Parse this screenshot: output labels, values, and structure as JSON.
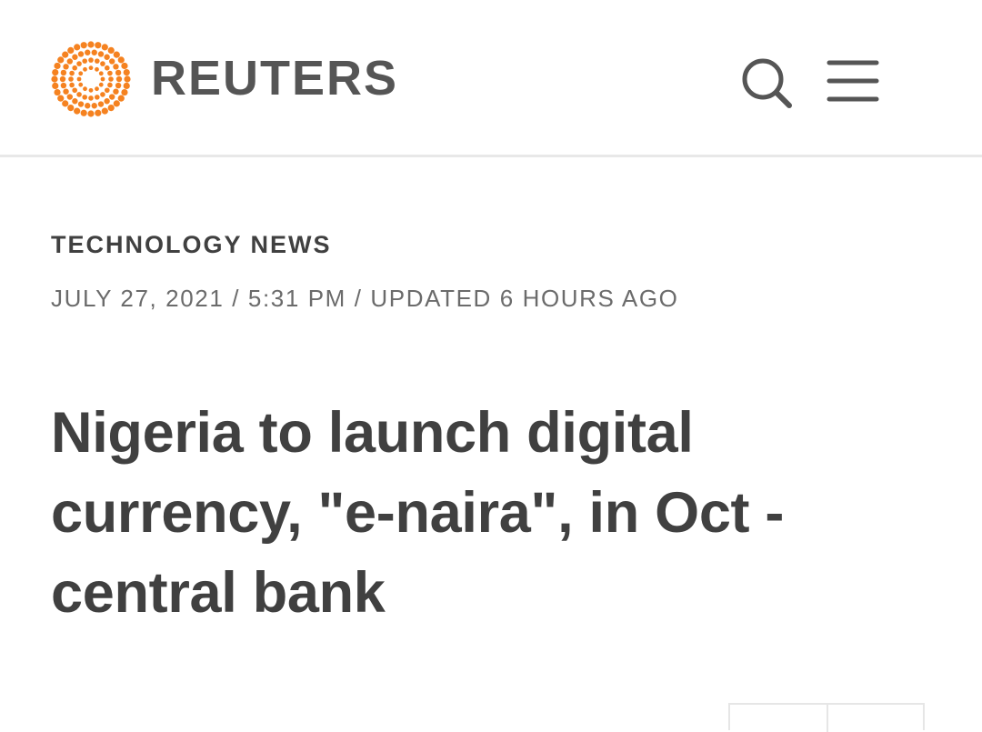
{
  "header": {
    "brand": "REUTERS",
    "logo_icon": "reuters-dot-ring-logo",
    "logo_color": "#f58220",
    "search_icon": "search-icon",
    "menu_icon": "hamburger-menu-icon"
  },
  "article": {
    "section": "TECHNOLOGY NEWS",
    "dateline": "JULY 27, 2021 / 5:31 PM / UPDATED 6 HOURS AGO",
    "headline": "Nigeria to launch digital currency, \"e-naira\", in Oct - central bank"
  },
  "colors": {
    "text_primary": "#404040",
    "text_secondary": "#6b6b6b",
    "brand_orange": "#f58220",
    "divider": "#e8e8e8"
  }
}
